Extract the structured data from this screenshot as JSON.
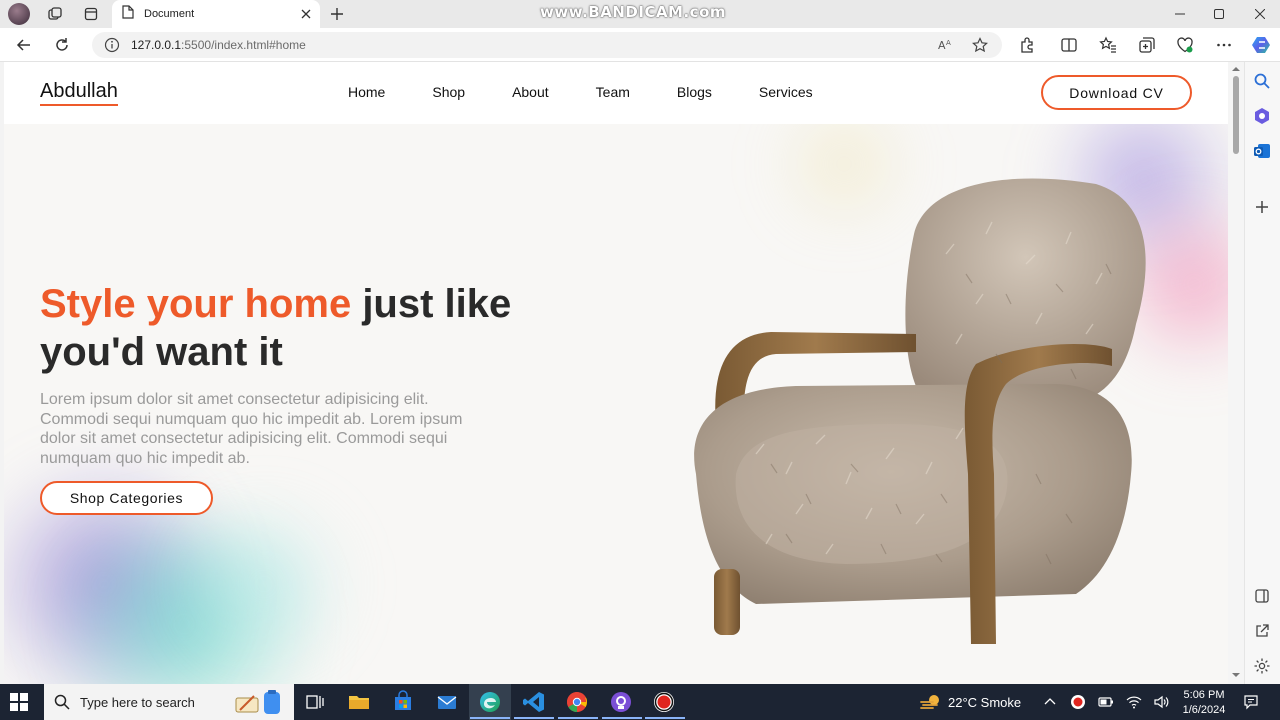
{
  "browser": {
    "tab_title": "Document",
    "url_host": "127.0.0.1",
    "url_rest": ":5500/index.html#home",
    "watermark": "www.BANDICAM.com"
  },
  "site": {
    "logo": "Abdullah",
    "nav": [
      "Home",
      "Shop",
      "About",
      "Team",
      "Blogs",
      "Services"
    ],
    "cta": "Download CV",
    "hero": {
      "title_accent": "Style your home",
      "title_rest": " just like you'd want it",
      "text": "Lorem ipsum dolor sit amet consectetur adipisicing elit. Commodi sequi numquam quo hic impedit ab. Lorem ipsum dolor sit amet consectetur adipisicing elit. Commodi sequi numquam quo hic impedit ab.",
      "button": "Shop Categories"
    }
  },
  "taskbar": {
    "search_placeholder": "Type here to search",
    "weather": "22°C  Smoke",
    "time": "5:06 PM",
    "date": "1/6/2024"
  },
  "colors": {
    "accent": "#ee5a2a",
    "heading": "#2a2a2a",
    "body_text": "#9a9a9a",
    "taskbar": "#1c2433"
  }
}
